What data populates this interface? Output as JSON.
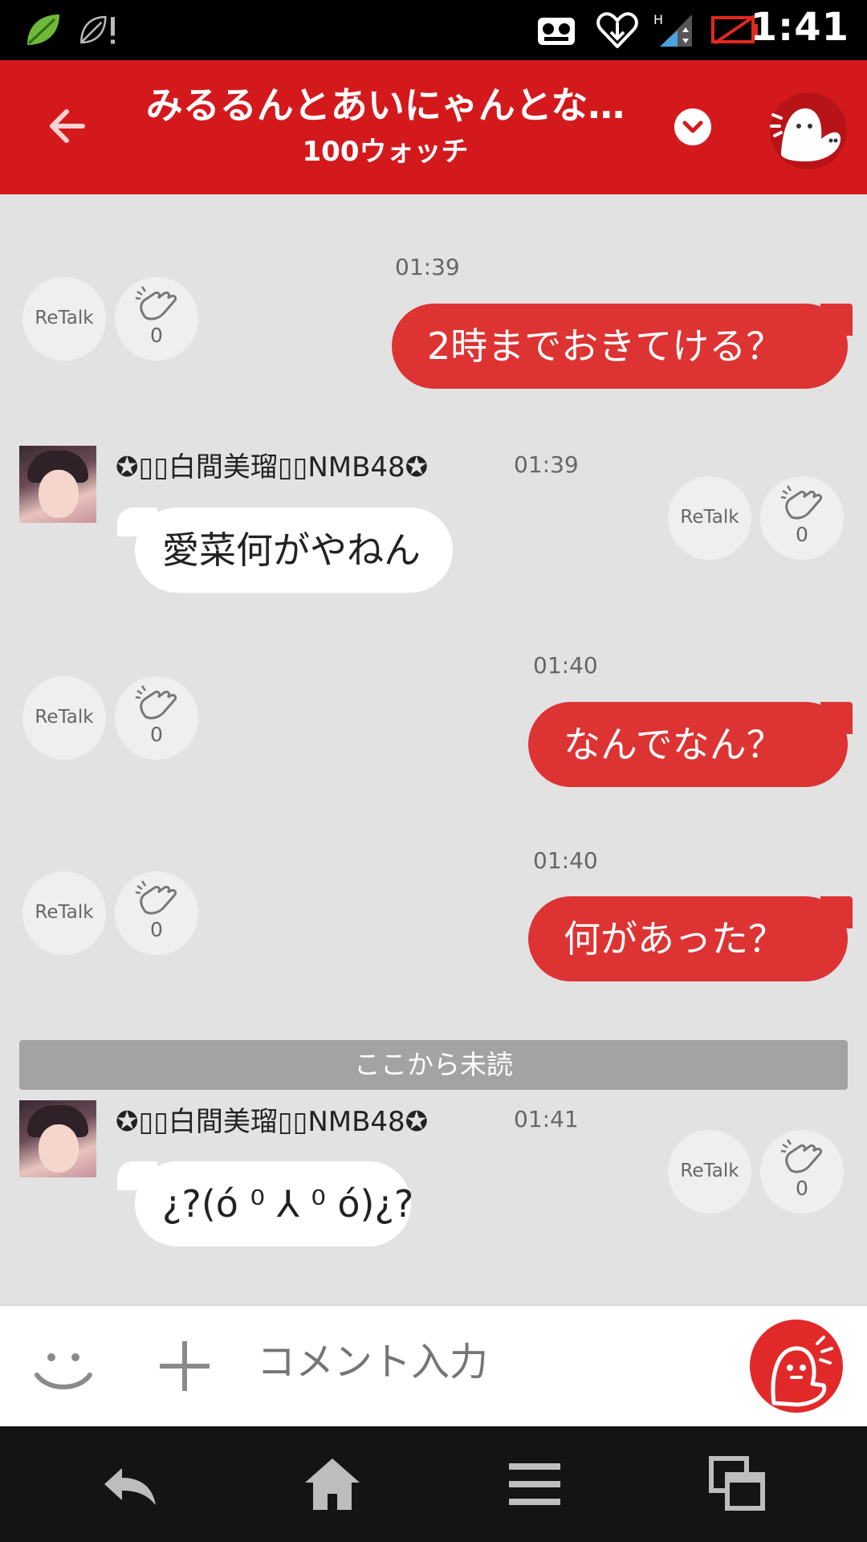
{
  "status_bar": {
    "time": "1:41"
  },
  "header": {
    "title": "みるるんとあいにゃんとな…",
    "subtitle": "100ウォッチ"
  },
  "messages": [
    {
      "time": "01:39",
      "text": "2時までおきてける？",
      "retalk": "ReTalk",
      "claps": "0"
    },
    {
      "sender": "✪▯▯白間美瑠▯▯NMB48✪",
      "time": "01:39",
      "text": "愛菜何がやねん",
      "retalk": "ReTalk",
      "claps": "0"
    },
    {
      "time": "01:40",
      "text": "なんでなん？",
      "retalk": "ReTalk",
      "claps": "0"
    },
    {
      "time": "01:40",
      "text": "何があった？",
      "retalk": "ReTalk",
      "claps": "0"
    },
    {
      "sender": "✪▯▯白間美瑠▯▯NMB48✪",
      "time": "01:41",
      "text": "¿?(ó ⁰ ⅄ ⁰ ó)¿?",
      "retalk": "ReTalk",
      "claps": "0"
    }
  ],
  "unread_divider": "ここから未読",
  "input": {
    "placeholder": "コメント入力"
  },
  "colors": {
    "brand_red": "#d4191d",
    "bubble_red": "#dd3333",
    "background": "#e2e2e2"
  },
  "icons": [
    "back-arrow-icon",
    "chevron-down-icon",
    "mascot-icon",
    "clap-icon",
    "smiley-icon",
    "plus-icon",
    "send-mascot-icon",
    "nav-back-icon",
    "nav-home-icon",
    "nav-menu-icon",
    "nav-recents-icon"
  ]
}
